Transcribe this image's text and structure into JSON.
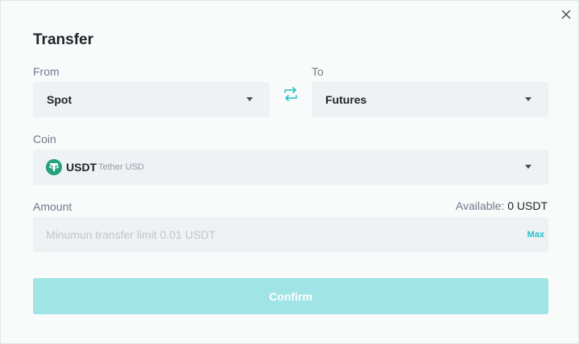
{
  "dialog": {
    "title": "Transfer",
    "close_icon": "close-icon"
  },
  "from": {
    "label": "From",
    "value": "Spot",
    "icon": "chevron-down-icon"
  },
  "swap": {
    "icon": "swap-arrows-icon",
    "color": "#26c2c9"
  },
  "to": {
    "label": "To",
    "value": "Futures",
    "icon": "chevron-down-icon"
  },
  "coin": {
    "label": "Coin",
    "symbol": "USDT",
    "name": "Tether USD",
    "icon": "tether-icon",
    "icon_color": "#26a17b"
  },
  "amount": {
    "label": "Amount",
    "available_label": "Available:",
    "available_value": "0 USDT",
    "value": "",
    "placeholder": "Minumun transfer limit 0.01 USDT",
    "max_label": "Max"
  },
  "confirm": {
    "label": "Confirm",
    "color": "#a0e4e5"
  }
}
